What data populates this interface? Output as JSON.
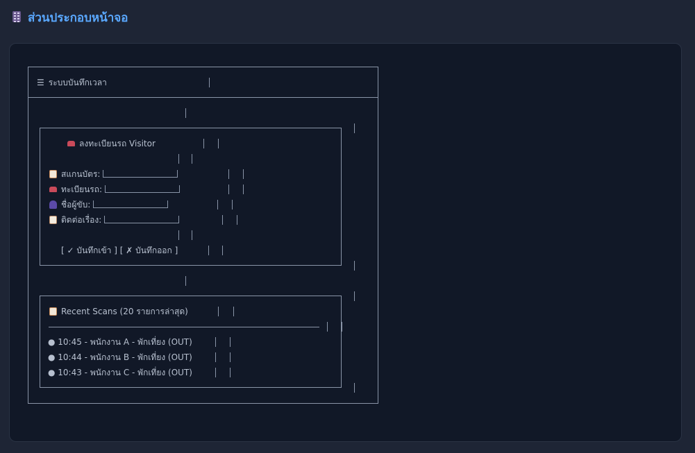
{
  "header": {
    "title": "ส่วนประกอบหน้าจอ",
    "icon": "abacus-icon"
  },
  "app": {
    "title": "ระบบบันทึกเวลา",
    "menu_icon": "☰"
  },
  "visitor": {
    "title": "ลงทะเบียนรถ Visitor",
    "fields": [
      {
        "label": "สแกนบัตร:",
        "icon": "clipboard-icon"
      },
      {
        "label": "ทะเบียนรถ:",
        "icon": "car-icon"
      },
      {
        "label": "ชื่อผู้ขับ:",
        "icon": "user-icon"
      },
      {
        "label": "ติดต่อเรื่อง:",
        "icon": "memo-icon"
      }
    ],
    "checkin_label": "✓ บันทึกเข้า",
    "checkout_label": "✗ บันทึกออก"
  },
  "recent": {
    "title": "Recent Scans (20 รายการล่าสุด)",
    "items": [
      "● 10:45 - พนักงาน A - พักเที่ยง (OUT)",
      "● 10:44 - พนักงาน B - พักเที่ยง (OUT)",
      "● 10:43 - พนักงาน C - พักเที่ยง (OUT)"
    ]
  }
}
